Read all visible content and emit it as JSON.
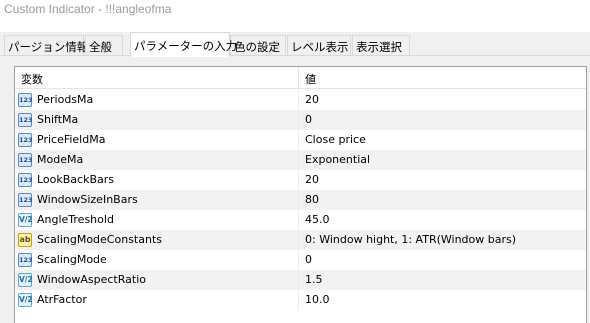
{
  "window": {
    "title": "Custom Indicator - !!!angleofma"
  },
  "tabs": [
    {
      "label": "パージョン情報"
    },
    {
      "label": "全般"
    },
    {
      "label": "パラメーターの入力",
      "active": true
    },
    {
      "label": "色の設定"
    },
    {
      "label": "レベル表示"
    },
    {
      "label": "表示選択"
    }
  ],
  "table": {
    "header": {
      "variable": "変数",
      "value": "値"
    },
    "rows": [
      {
        "icon": "123",
        "icon_name": "integer-type-icon",
        "name": "PeriodsMa",
        "value": "20"
      },
      {
        "icon": "123",
        "icon_name": "integer-type-icon",
        "name": "ShiftMa",
        "value": "0"
      },
      {
        "icon": "123",
        "icon_name": "integer-type-icon",
        "name": "PriceFieldMa",
        "value": "Close price"
      },
      {
        "icon": "123",
        "icon_name": "integer-type-icon",
        "name": "ModeMa",
        "value": "Exponential"
      },
      {
        "icon": "123",
        "icon_name": "integer-type-icon",
        "name": "LookBackBars",
        "value": "20"
      },
      {
        "icon": "123",
        "icon_name": "integer-type-icon",
        "name": "WindowSizeInBars",
        "value": "80"
      },
      {
        "icon": "V/2",
        "icon_name": "double-type-icon",
        "name": "AngleTreshold",
        "value": "45.0"
      },
      {
        "icon": "ab",
        "icon_name": "string-type-icon",
        "name": "ScalingModeConstants",
        "value": "0: Window hight, 1: ATR(Window bars)"
      },
      {
        "icon": "123",
        "icon_name": "integer-type-icon",
        "name": "ScalingMode",
        "value": "0"
      },
      {
        "icon": "V/2",
        "icon_name": "double-type-icon",
        "name": "WindowAspectRatio",
        "value": "1.5"
      },
      {
        "icon": "V/2",
        "icon_name": "double-type-icon",
        "name": "AtrFactor",
        "value": "10.0"
      }
    ]
  }
}
